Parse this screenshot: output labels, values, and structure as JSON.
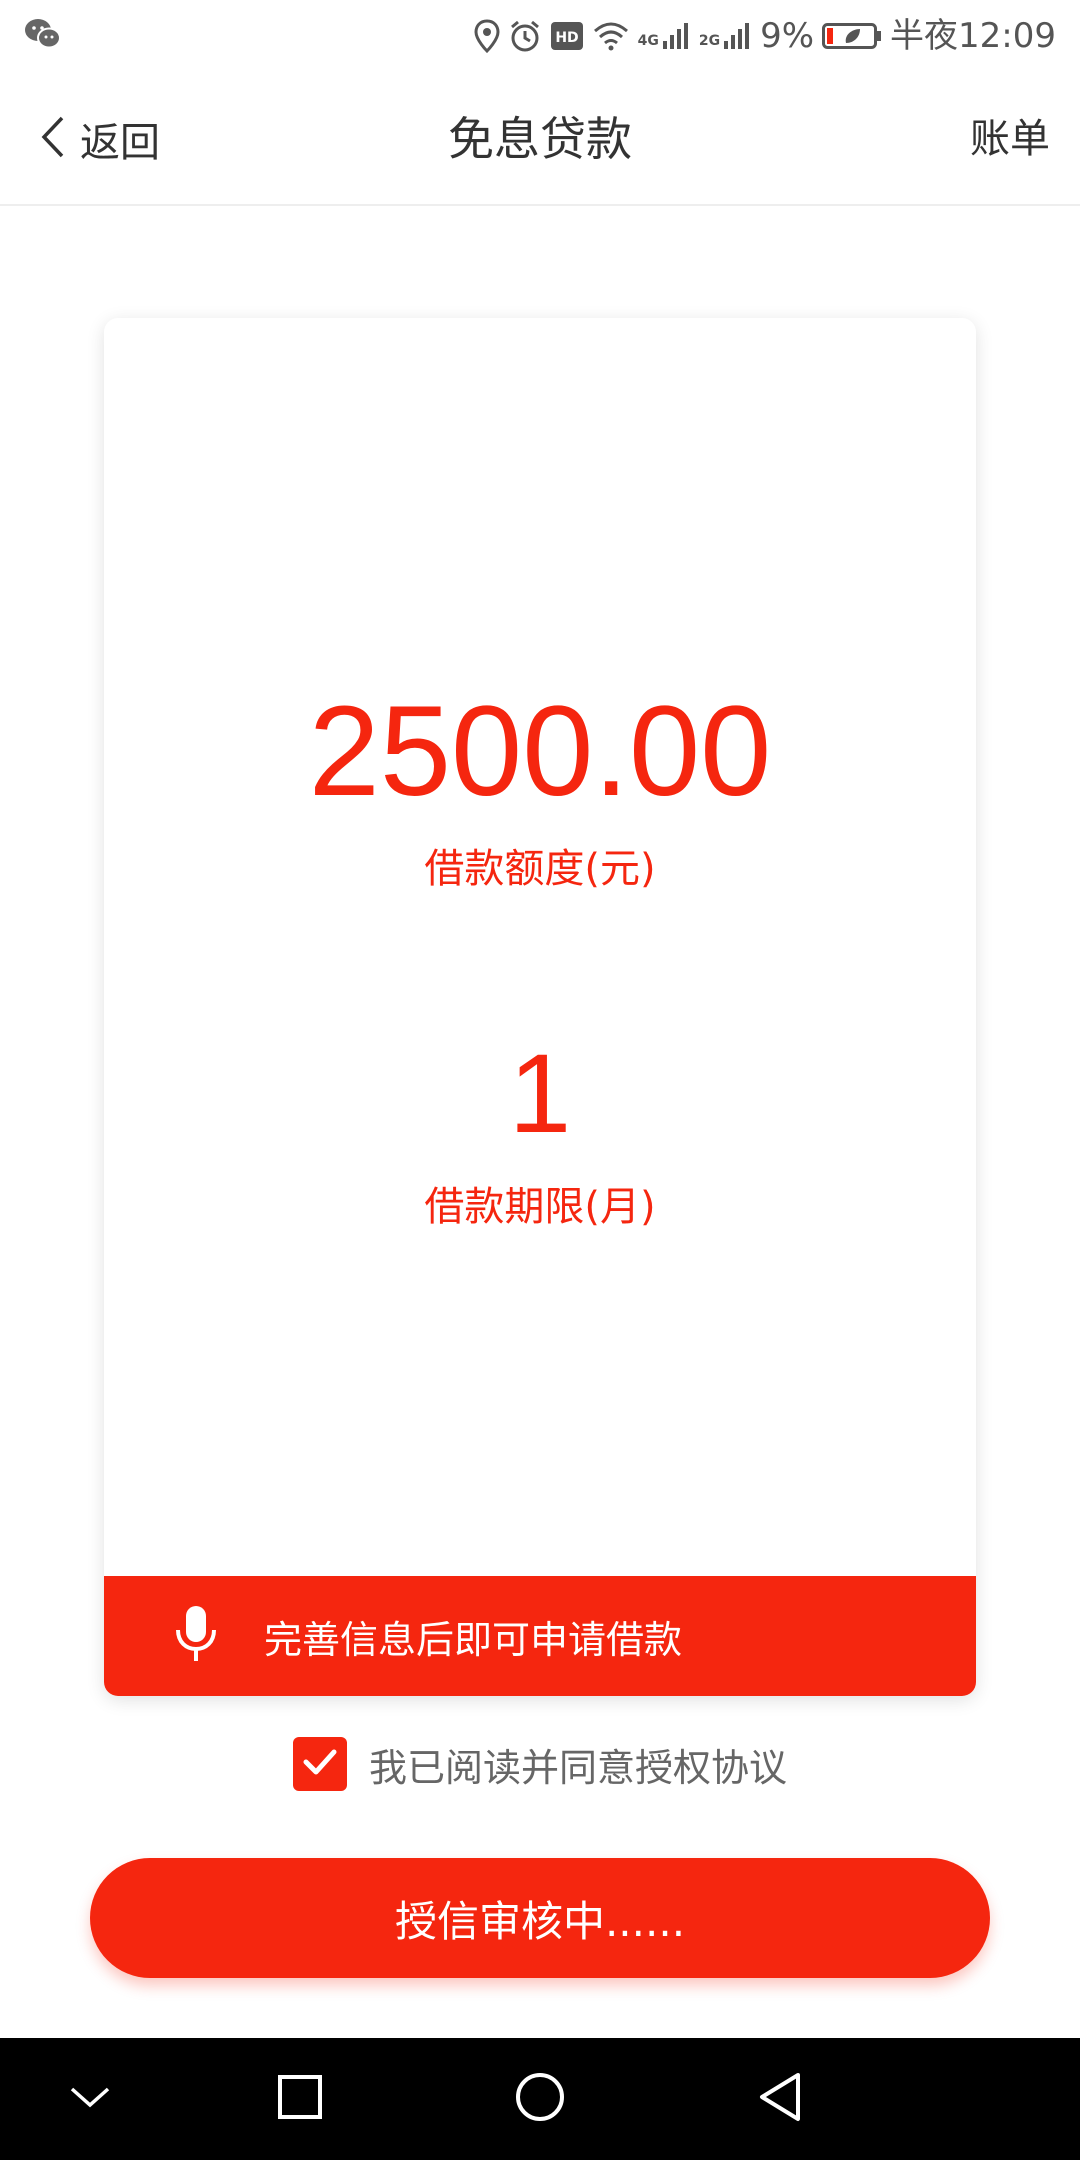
{
  "status_bar": {
    "battery_percent": "9%",
    "time": "半夜12:09",
    "network_4g": "4G",
    "network_2g": "2G",
    "icons": [
      "wechat-icon",
      "location-icon",
      "alarm-icon",
      "hd-icon",
      "wifi-icon",
      "signal-icon",
      "battery-icon"
    ]
  },
  "nav": {
    "back_label": "返回",
    "title": "免息贷款",
    "right_label": "账单"
  },
  "loan": {
    "amount": "2500.00",
    "amount_label": "借款额度(元)",
    "term": "1",
    "term_label": "借款期限(月)",
    "notice": "完善信息后即可申请借款"
  },
  "agreement": {
    "checked": true,
    "text": "我已阅读并同意授权协议"
  },
  "submit": {
    "label": "授信审核中......"
  },
  "theme": {
    "accent": "#f5260f",
    "text": "#333333",
    "muted": "#666666",
    "system_nav_bg": "#000000"
  },
  "system_nav": {
    "icons": [
      "chevron-down-icon",
      "recents-square-icon",
      "home-circle-icon",
      "back-triangle-icon"
    ]
  }
}
